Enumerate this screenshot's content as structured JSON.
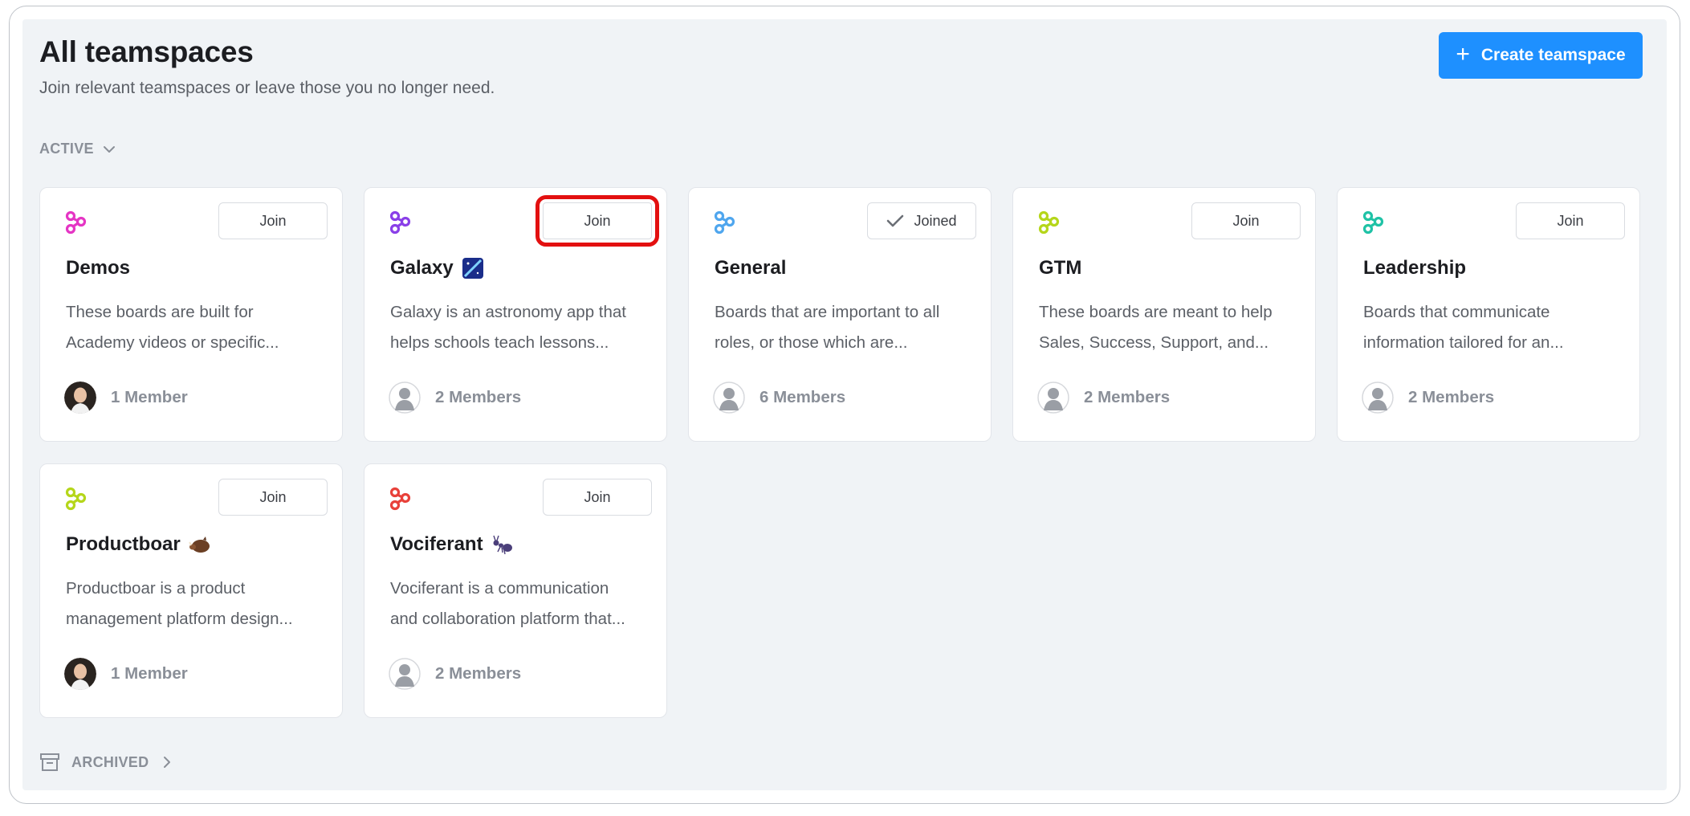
{
  "header": {
    "title": "All teamspaces",
    "subtitle": "Join relevant teamspaces or leave those you no longer need.",
    "create_button": "Create teamspace"
  },
  "sections": {
    "active_label": "ACTIVE",
    "archived_label": "ARCHIVED"
  },
  "teamspaces": [
    {
      "name": "Demos",
      "description_1": "These boards are built for",
      "description_2": "Academy videos or specific...",
      "members": "1 Member",
      "button": "Join",
      "icon_color": "#e535c4",
      "avatar": "photo-avatar"
    },
    {
      "name": "Galaxy",
      "description_1": "Galaxy is an astronomy app that",
      "description_2": "helps schools teach lessons...",
      "members": "2 Members",
      "button": "Join",
      "icon_color": "#8a3fe8",
      "avatar": "default-avatar",
      "emoji": "galaxy-emoji"
    },
    {
      "name": "General",
      "description_1": "Boards that are important to all",
      "description_2": "roles, or those which are...",
      "members": "6 Members",
      "button": "Joined",
      "icon_color": "#4fa6ee",
      "avatar": "default-avatar"
    },
    {
      "name": "GTM",
      "description_1": "These boards are meant to help",
      "description_2": "Sales, Success, Support, and...",
      "members": "2 Members",
      "button": "Join",
      "icon_color": "#b5d61a",
      "avatar": "default-avatar"
    },
    {
      "name": "Leadership",
      "description_1": "Boards that communicate",
      "description_2": "information tailored for an...",
      "members": "2 Members",
      "button": "Join",
      "icon_color": "#1fc2a6",
      "avatar": "default-avatar"
    },
    {
      "name": "Productboar",
      "description_1": "Productboar is a product",
      "description_2": "management platform design...",
      "members": "1 Member",
      "button": "Join",
      "icon_color": "#b5d61a",
      "avatar": "photo-avatar",
      "emoji": "boar-emoji"
    },
    {
      "name": "Vociferant",
      "description_1": "Vociferant is a communication",
      "description_2": "and collaboration platform that...",
      "members": "2 Members",
      "button": "Join",
      "icon_color": "#e8413a",
      "avatar": "default-avatar",
      "emoji": "ant-emoji"
    }
  ],
  "colors": {
    "accent": "#1e90ff",
    "panel_bg": "#f0f3f6",
    "highlight": "#e31010"
  }
}
